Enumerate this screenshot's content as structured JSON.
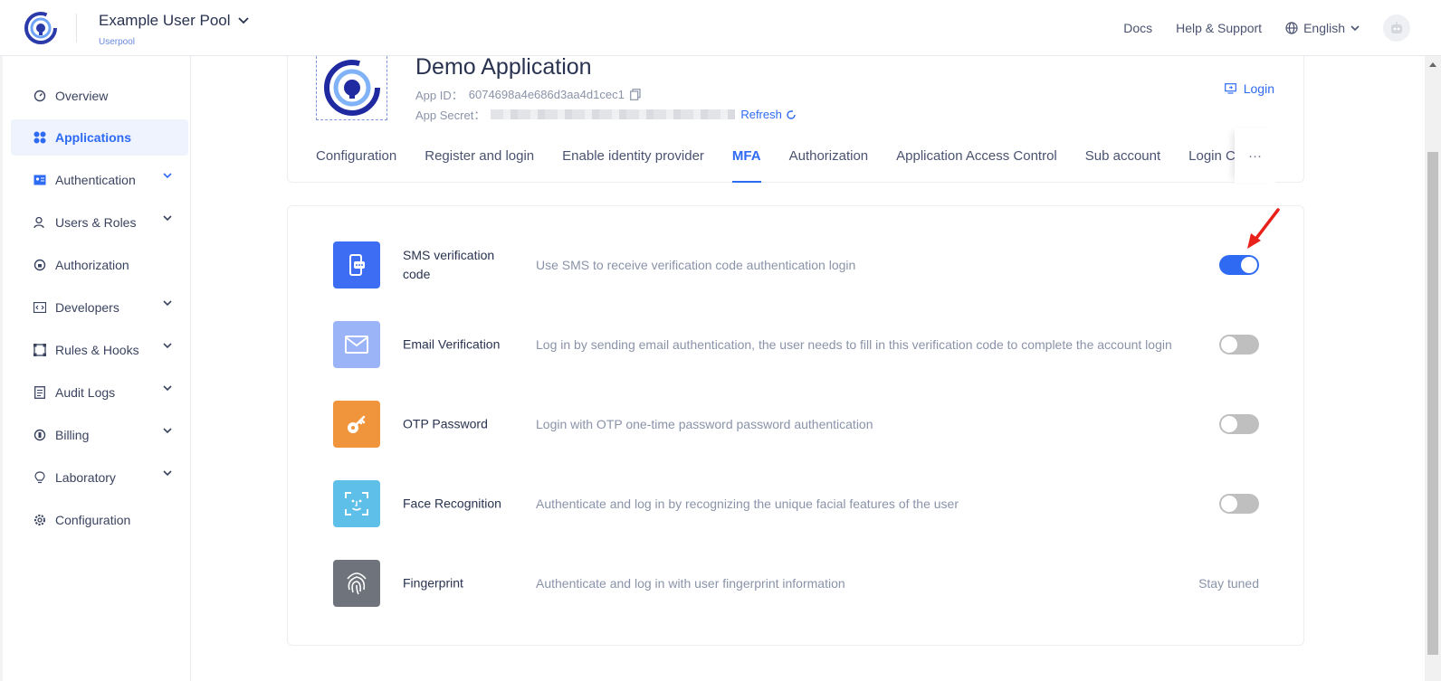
{
  "header": {
    "pool_name": "Example User Pool",
    "pool_subtitle": "Userpool",
    "docs": "Docs",
    "help": "Help & Support",
    "language": "English"
  },
  "sidebar": {
    "items": [
      {
        "label": "Overview",
        "icon": "dashboard-icon",
        "expandable": false,
        "active": false
      },
      {
        "label": "Applications",
        "icon": "apps-icon",
        "expandable": false,
        "active": true
      },
      {
        "label": "Authentication",
        "icon": "id-card-icon",
        "expandable": true,
        "active": false
      },
      {
        "label": "Users & Roles",
        "icon": "user-icon",
        "expandable": true,
        "active": false
      },
      {
        "label": "Authorization",
        "icon": "lock-icon",
        "expandable": false,
        "active": false
      },
      {
        "label": "Developers",
        "icon": "code-icon",
        "expandable": true,
        "active": false
      },
      {
        "label": "Rules & Hooks",
        "icon": "nodes-icon",
        "expandable": true,
        "active": false
      },
      {
        "label": "Audit Logs",
        "icon": "log-icon",
        "expandable": true,
        "active": false
      },
      {
        "label": "Billing",
        "icon": "billing-icon",
        "expandable": true,
        "active": false
      },
      {
        "label": "Laboratory",
        "icon": "bulb-icon",
        "expandable": true,
        "active": false
      },
      {
        "label": "Configuration",
        "icon": "gear-icon",
        "expandable": false,
        "active": false
      }
    ]
  },
  "app": {
    "title": "Demo Application",
    "app_id_label": "App ID：",
    "app_id": "6074698a4e686d3aa4d1cec1",
    "app_secret_label": "App Secret：",
    "refresh": "Refresh",
    "login": "Login"
  },
  "tabs": [
    {
      "label": "Configuration",
      "active": false
    },
    {
      "label": "Register and login",
      "active": false
    },
    {
      "label": "Enable identity provider",
      "active": false
    },
    {
      "label": "MFA",
      "active": true
    },
    {
      "label": "Authorization",
      "active": false
    },
    {
      "label": "Application Access Control",
      "active": false
    },
    {
      "label": "Sub account",
      "active": false
    },
    {
      "label": "Login Control",
      "active": false
    }
  ],
  "tab_more": "···",
  "mfa": [
    {
      "name": "SMS verification code",
      "description": "Use SMS to receive verification code authentication login",
      "icon": "sms-icon",
      "color": "#3d6df2",
      "enabled": true
    },
    {
      "name": "Email Verification",
      "description": "Log in by sending email authentication, the user needs to fill in this verification code to complete the account login",
      "icon": "email-icon",
      "color": "#9bb3f7",
      "enabled": false
    },
    {
      "name": "OTP Password",
      "description": "Login with OTP one-time password password authentication",
      "icon": "key-icon",
      "color": "#f0953b",
      "enabled": false
    },
    {
      "name": "Face Recognition",
      "description": "Authenticate and log in by recognizing the unique facial features of the user",
      "icon": "face-scan-icon",
      "color": "#5ec0e8",
      "enabled": false
    },
    {
      "name": "Fingerprint",
      "description": "Authenticate and log in with user fingerprint information",
      "icon": "fingerprint-icon",
      "color": "#6f747c",
      "status": "Stay tuned"
    }
  ],
  "colors": {
    "accent": "#2e6af2",
    "annotation_arrow": "#e8221a"
  }
}
